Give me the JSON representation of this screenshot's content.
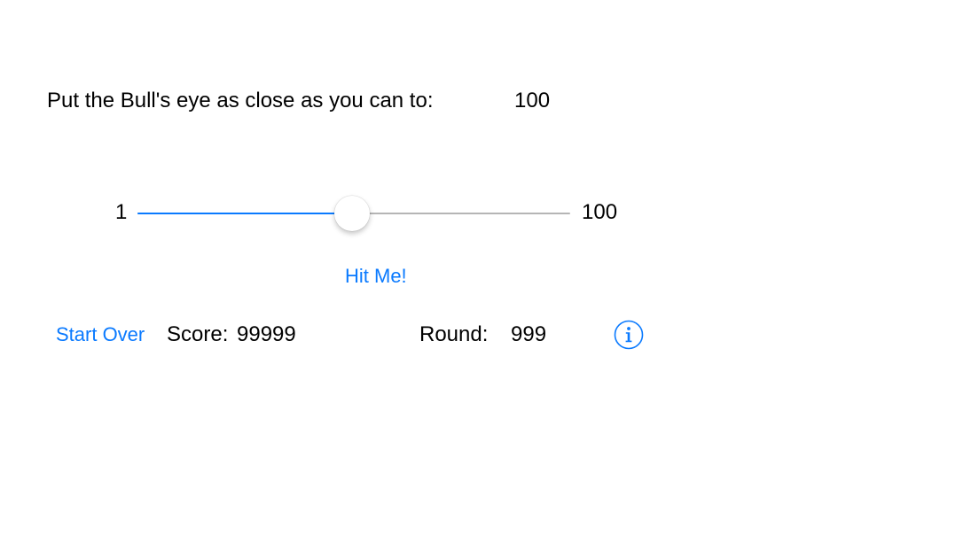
{
  "game": {
    "prompt": "Put the Bull's eye as close as you can to:",
    "target_value": "100"
  },
  "slider": {
    "min_label": "1",
    "max_label": "100",
    "min": 1,
    "max": 100,
    "value": 50
  },
  "actions": {
    "hit_me_label": "Hit Me!",
    "start_over_label": "Start Over"
  },
  "status": {
    "score_label": "Score:",
    "score_value": "99999",
    "round_label": "Round:",
    "round_value": "999"
  },
  "icons": {
    "info": "info-icon"
  },
  "colors": {
    "accent": "#0a7aff",
    "track": "#b5b5b5",
    "text": "#000000",
    "background": "#ffffff"
  }
}
